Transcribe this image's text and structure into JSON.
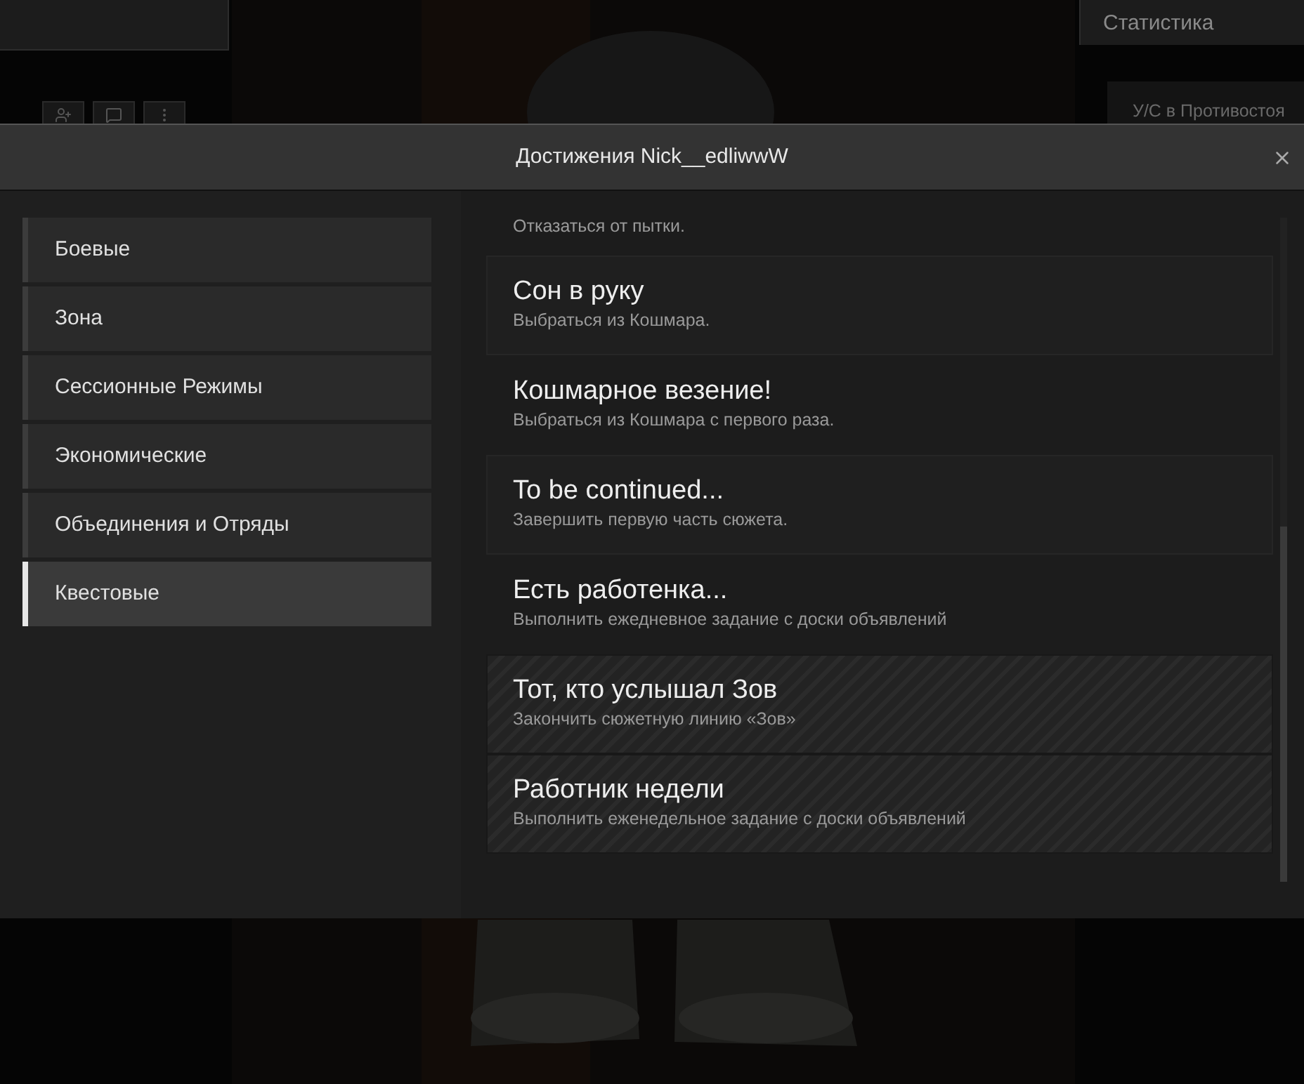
{
  "background": {
    "stats_title": "Статистика",
    "stats_row": "У/С в Противостоя"
  },
  "window": {
    "title": "Достижения Nick__edliwwW"
  },
  "sidebar": {
    "items": [
      {
        "label": "Боевые",
        "selected": false
      },
      {
        "label": "Зона",
        "selected": false
      },
      {
        "label": "Сессионные Режимы",
        "selected": false
      },
      {
        "label": "Экономические",
        "selected": false
      },
      {
        "label": "Объединения и Отряды",
        "selected": false
      },
      {
        "label": "Квестовые",
        "selected": true
      }
    ]
  },
  "achievements": [
    {
      "description": "Отказаться от пытки.",
      "completed": false
    },
    {
      "title": "Сон в руку",
      "description": "Выбраться из Кошмара.",
      "completed": false
    },
    {
      "title": "Кошмарное везение!",
      "description": "Выбраться из Кошмара с первого раза.",
      "completed": false
    },
    {
      "title": "To be continued...",
      "description": "Завершить первую часть сюжета.",
      "completed": false
    },
    {
      "title": "Есть работенка...",
      "description": "Выполнить ежедневное задание с доски объявлений",
      "completed": false
    },
    {
      "title": "Тот, кто услышал Зов",
      "description": "Закончить сюжетную линию «Зов»",
      "completed": true
    },
    {
      "title": "Работник недели",
      "description": "Выполнить еженедельное задание с доски объявлений",
      "completed": true
    }
  ]
}
